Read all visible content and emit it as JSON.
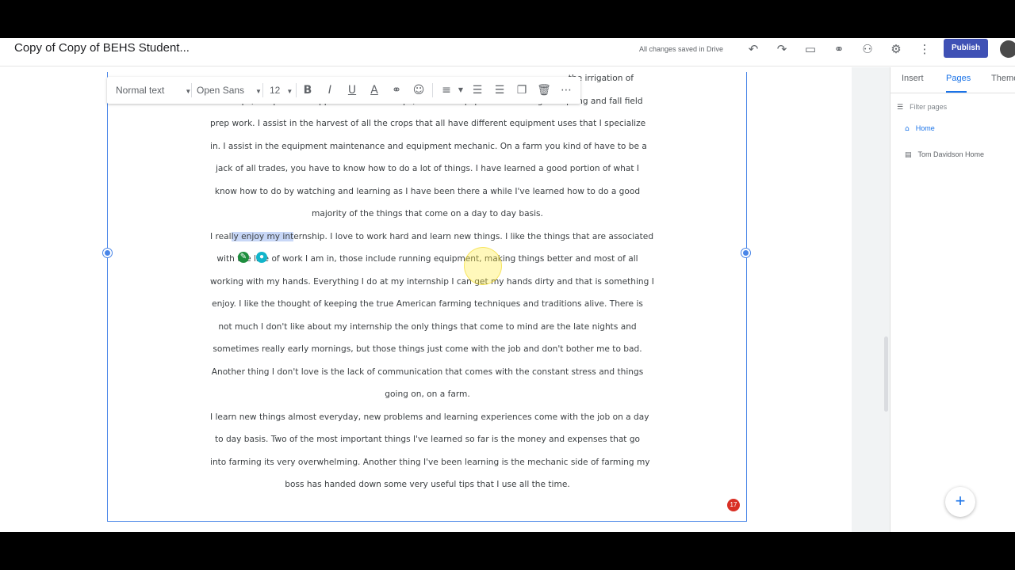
{
  "topbar": {
    "title": "Copy of Copy of BEHS Student...",
    "save_status": "All changes saved in Drive",
    "publish_label": "Publish"
  },
  "format_toolbar": {
    "style": "Normal text",
    "font": "Open Sans",
    "size": "12"
  },
  "body": {
    "lines": [
      "the irrigation of",
      "the crops, the pesticide application of the crops, I run the equipment including the spring and fall field",
      "prep work. I assist in the harvest of all the crops that all have different equipment uses that I specialize",
      "in. I assist in the equipment maintenance and equipment mechanic. On a farm you kind of have to be a",
      "jack of all trades, you have to know how to do a lot of things. I have learned a good portion of what I",
      "know how to do by watching and learning as I have been there a while I've learned how to do a good",
      "majority of the things that come on a day to day basis.",
      "I really enjoy my internship. I love to work hard and learn new things. I like the things that are associated",
      "with the line of work I am in, those include running equipment, making things better and most of all",
      "working with my hands. Everything I do at my internship I can get my hands dirty and that is something I",
      "enjoy. I like the thought of keeping the true American farming techniques and traditions alive. There is",
      "not much I don't like about my internship the only things that come to mind are the late nights and",
      "sometimes really early mornings, but those things just come with the job and don't bother me to bad.",
      "Another thing I don't love is the lack of communication that comes with the constant stress and things",
      "going on, on a farm.",
      "I learn new things almost everyday, new problems and learning experiences come with the job on a day",
      "to day basis. Two of the most important things I've learned so far is the money and expenses that go",
      "into farming its very overwhelming. Another thing I've been learning is the mechanic side of farming my",
      "boss has handed down some very useful tips that I use all the time."
    ],
    "selection_prefix": "I real",
    "selection": "ly enjoy my int",
    "selection_suffix": "ernship. I love to work hard and learn new things. I like the things that are associated"
  },
  "badge_count": "17",
  "right_panel": {
    "tabs": [
      "Insert",
      "Pages",
      "Themes"
    ],
    "filter_placeholder": "Filter pages",
    "pages": [
      "Home",
      "Tom Davidson Home"
    ]
  },
  "colors": {
    "accent": "#1a73e8",
    "publish": "#3f51b5",
    "selection": "#c8d7f7"
  },
  "icons": [
    "undo-icon",
    "redo-icon",
    "preview-icon",
    "link-icon",
    "share-icon",
    "settings-icon",
    "more-icon"
  ]
}
